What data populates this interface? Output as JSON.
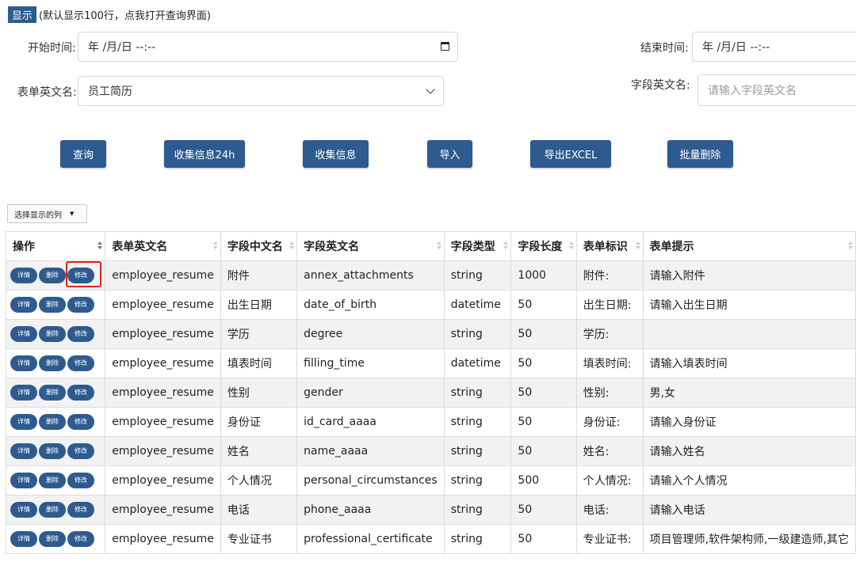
{
  "topbar": {
    "show_label": "显示",
    "note": "(默认显示100行，点我打开查询界面)"
  },
  "filters": {
    "start_time_label": "开始时间:",
    "start_time_value": "年 /月/日 --:--",
    "end_time_label": "结束时间:",
    "end_time_value": "年 /月/日 --:--",
    "form_name_label": "表单英文名:",
    "form_name_value": "员工简历",
    "field_name_label": "字段英文名:",
    "field_name_placeholder": "请输入字段英文名"
  },
  "actions": {
    "query": "查询",
    "collect_24h": "收集信息24h",
    "collect": "收集信息",
    "import": "导入",
    "export": "导出EXCEL",
    "batch_delete": "批量删除"
  },
  "column_selector": "选择显示的列",
  "table": {
    "headers": [
      "操作",
      "表单英文名",
      "字段中文名",
      "字段英文名",
      "字段类型",
      "字段长度",
      "表单标识",
      "表单提示"
    ],
    "row_buttons": {
      "detail": "详情",
      "delete": "删除",
      "edit": "修改"
    },
    "rows": [
      [
        "employee_resume",
        "附件",
        "annex_attachments",
        "string",
        "1000",
        "附件:",
        "请输入附件"
      ],
      [
        "employee_resume",
        "出生日期",
        "date_of_birth",
        "datetime",
        "50",
        "出生日期:",
        "请输入出生日期"
      ],
      [
        "employee_resume",
        "学历",
        "degree",
        "string",
        "50",
        "学历:",
        ""
      ],
      [
        "employee_resume",
        "填表时间",
        "filling_time",
        "datetime",
        "50",
        "填表时间:",
        "请输入填表时间"
      ],
      [
        "employee_resume",
        "性别",
        "gender",
        "string",
        "50",
        "性别:",
        "男,女"
      ],
      [
        "employee_resume",
        "身份证",
        "id_card_aaaa",
        "string",
        "50",
        "身份证:",
        "请输入身份证"
      ],
      [
        "employee_resume",
        "姓名",
        "name_aaaa",
        "string",
        "50",
        "姓名:",
        "请输入姓名"
      ],
      [
        "employee_resume",
        "个人情况",
        "personal_circumstances",
        "string",
        "500",
        "个人情况:",
        "请输入个人情况"
      ],
      [
        "employee_resume",
        "电话",
        "phone_aaaa",
        "string",
        "50",
        "电话:",
        "请输入电话"
      ],
      [
        "employee_resume",
        "专业证书",
        "professional_certificate",
        "string",
        "50",
        "专业证书:",
        "项目管理师,软件架构师,一级建造师,其它"
      ]
    ]
  },
  "colors": {
    "primary": "#2e5b8f",
    "highlight": "#e2231a",
    "row_alt": "#f2f2f2"
  }
}
